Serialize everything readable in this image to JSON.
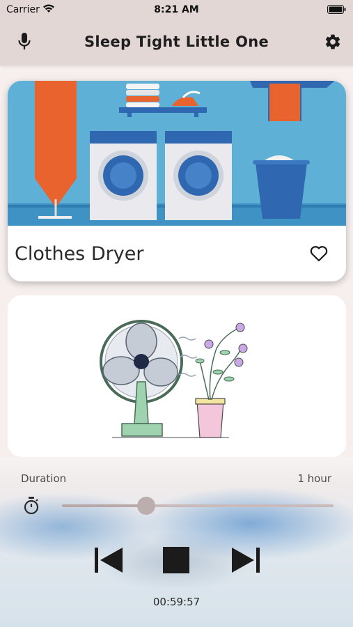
{
  "status_bar": {
    "carrier": "Carrier",
    "time": "8:21 AM"
  },
  "nav": {
    "title": "Sleep Tight Little One",
    "left_icon": "mic-icon",
    "right_icon": "gear-icon"
  },
  "sounds": [
    {
      "name": "Clothes Dryer",
      "favorite": false,
      "illustration": "laundry-room"
    },
    {
      "name": "",
      "illustration": "fan-and-plant"
    }
  ],
  "player": {
    "duration_label": "Duration",
    "duration_value": "1 hour",
    "slider_fraction": 0.31,
    "elapsed": "00:59:57"
  },
  "colors": {
    "nav_bg": "#e3d7d6",
    "page_bg": "#f6efee",
    "accent": "#bcaeae"
  }
}
